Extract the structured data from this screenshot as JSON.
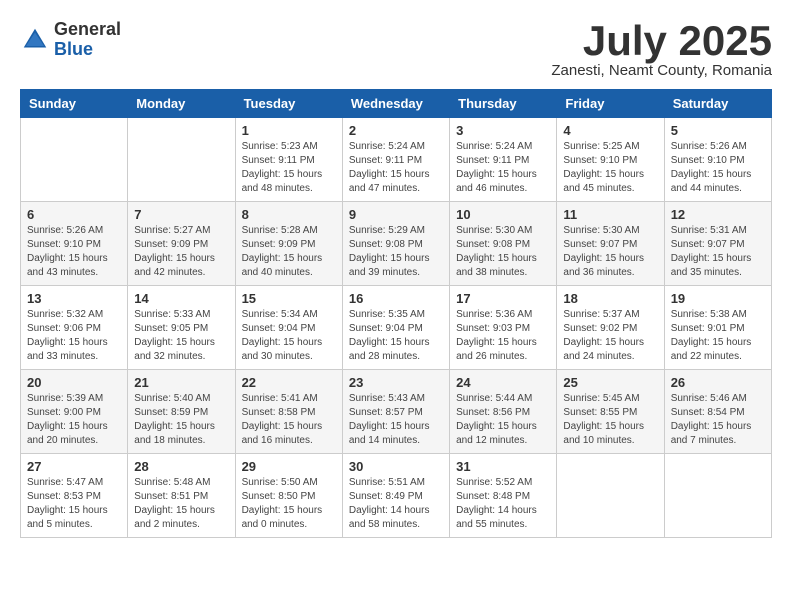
{
  "header": {
    "logo_general": "General",
    "logo_blue": "Blue",
    "month_title": "July 2025",
    "subtitle": "Zanesti, Neamt County, Romania"
  },
  "days_of_week": [
    "Sunday",
    "Monday",
    "Tuesday",
    "Wednesday",
    "Thursday",
    "Friday",
    "Saturday"
  ],
  "weeks": [
    [
      {
        "day": "",
        "info": ""
      },
      {
        "day": "",
        "info": ""
      },
      {
        "day": "1",
        "info": "Sunrise: 5:23 AM\nSunset: 9:11 PM\nDaylight: 15 hours\nand 48 minutes."
      },
      {
        "day": "2",
        "info": "Sunrise: 5:24 AM\nSunset: 9:11 PM\nDaylight: 15 hours\nand 47 minutes."
      },
      {
        "day": "3",
        "info": "Sunrise: 5:24 AM\nSunset: 9:11 PM\nDaylight: 15 hours\nand 46 minutes."
      },
      {
        "day": "4",
        "info": "Sunrise: 5:25 AM\nSunset: 9:10 PM\nDaylight: 15 hours\nand 45 minutes."
      },
      {
        "day": "5",
        "info": "Sunrise: 5:26 AM\nSunset: 9:10 PM\nDaylight: 15 hours\nand 44 minutes."
      }
    ],
    [
      {
        "day": "6",
        "info": "Sunrise: 5:26 AM\nSunset: 9:10 PM\nDaylight: 15 hours\nand 43 minutes."
      },
      {
        "day": "7",
        "info": "Sunrise: 5:27 AM\nSunset: 9:09 PM\nDaylight: 15 hours\nand 42 minutes."
      },
      {
        "day": "8",
        "info": "Sunrise: 5:28 AM\nSunset: 9:09 PM\nDaylight: 15 hours\nand 40 minutes."
      },
      {
        "day": "9",
        "info": "Sunrise: 5:29 AM\nSunset: 9:08 PM\nDaylight: 15 hours\nand 39 minutes."
      },
      {
        "day": "10",
        "info": "Sunrise: 5:30 AM\nSunset: 9:08 PM\nDaylight: 15 hours\nand 38 minutes."
      },
      {
        "day": "11",
        "info": "Sunrise: 5:30 AM\nSunset: 9:07 PM\nDaylight: 15 hours\nand 36 minutes."
      },
      {
        "day": "12",
        "info": "Sunrise: 5:31 AM\nSunset: 9:07 PM\nDaylight: 15 hours\nand 35 minutes."
      }
    ],
    [
      {
        "day": "13",
        "info": "Sunrise: 5:32 AM\nSunset: 9:06 PM\nDaylight: 15 hours\nand 33 minutes."
      },
      {
        "day": "14",
        "info": "Sunrise: 5:33 AM\nSunset: 9:05 PM\nDaylight: 15 hours\nand 32 minutes."
      },
      {
        "day": "15",
        "info": "Sunrise: 5:34 AM\nSunset: 9:04 PM\nDaylight: 15 hours\nand 30 minutes."
      },
      {
        "day": "16",
        "info": "Sunrise: 5:35 AM\nSunset: 9:04 PM\nDaylight: 15 hours\nand 28 minutes."
      },
      {
        "day": "17",
        "info": "Sunrise: 5:36 AM\nSunset: 9:03 PM\nDaylight: 15 hours\nand 26 minutes."
      },
      {
        "day": "18",
        "info": "Sunrise: 5:37 AM\nSunset: 9:02 PM\nDaylight: 15 hours\nand 24 minutes."
      },
      {
        "day": "19",
        "info": "Sunrise: 5:38 AM\nSunset: 9:01 PM\nDaylight: 15 hours\nand 22 minutes."
      }
    ],
    [
      {
        "day": "20",
        "info": "Sunrise: 5:39 AM\nSunset: 9:00 PM\nDaylight: 15 hours\nand 20 minutes."
      },
      {
        "day": "21",
        "info": "Sunrise: 5:40 AM\nSunset: 8:59 PM\nDaylight: 15 hours\nand 18 minutes."
      },
      {
        "day": "22",
        "info": "Sunrise: 5:41 AM\nSunset: 8:58 PM\nDaylight: 15 hours\nand 16 minutes."
      },
      {
        "day": "23",
        "info": "Sunrise: 5:43 AM\nSunset: 8:57 PM\nDaylight: 15 hours\nand 14 minutes."
      },
      {
        "day": "24",
        "info": "Sunrise: 5:44 AM\nSunset: 8:56 PM\nDaylight: 15 hours\nand 12 minutes."
      },
      {
        "day": "25",
        "info": "Sunrise: 5:45 AM\nSunset: 8:55 PM\nDaylight: 15 hours\nand 10 minutes."
      },
      {
        "day": "26",
        "info": "Sunrise: 5:46 AM\nSunset: 8:54 PM\nDaylight: 15 hours\nand 7 minutes."
      }
    ],
    [
      {
        "day": "27",
        "info": "Sunrise: 5:47 AM\nSunset: 8:53 PM\nDaylight: 15 hours\nand 5 minutes."
      },
      {
        "day": "28",
        "info": "Sunrise: 5:48 AM\nSunset: 8:51 PM\nDaylight: 15 hours\nand 2 minutes."
      },
      {
        "day": "29",
        "info": "Sunrise: 5:50 AM\nSunset: 8:50 PM\nDaylight: 15 hours\nand 0 minutes."
      },
      {
        "day": "30",
        "info": "Sunrise: 5:51 AM\nSunset: 8:49 PM\nDaylight: 14 hours\nand 58 minutes."
      },
      {
        "day": "31",
        "info": "Sunrise: 5:52 AM\nSunset: 8:48 PM\nDaylight: 14 hours\nand 55 minutes."
      },
      {
        "day": "",
        "info": ""
      },
      {
        "day": "",
        "info": ""
      }
    ]
  ]
}
